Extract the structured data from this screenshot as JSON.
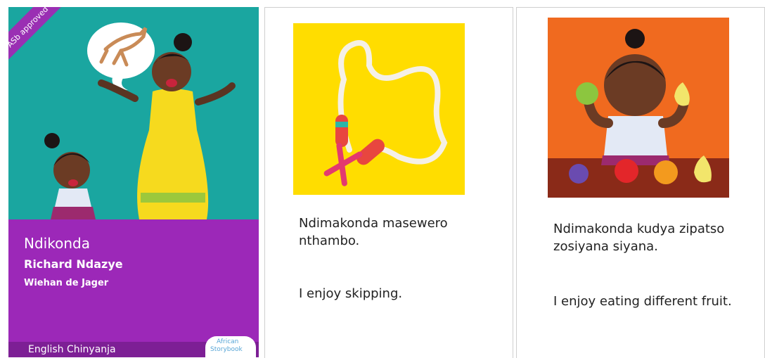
{
  "cover": {
    "badge": "ASb approved",
    "title": "Ndikonda",
    "author": "Richard Ndazye",
    "illustrator": "Wiehan de Jager",
    "languages": "English Chinyanja",
    "logo_line1": "African",
    "logo_line2": "Storybook"
  },
  "pages": [
    {
      "chinyanja": "Ndimakonda masewero nthambo.",
      "english": "I enjoy skipping."
    },
    {
      "chinyanja": "Ndimakonda kudya zipatso zosiyana siyana.",
      "english": "I enjoy eating different fruit."
    }
  ],
  "colors": {
    "cover_teal": "#1aa6a0",
    "cover_purple": "#9c28b8",
    "page1_bg": "#ffdd00",
    "page2_bg": "#f06a1f"
  }
}
